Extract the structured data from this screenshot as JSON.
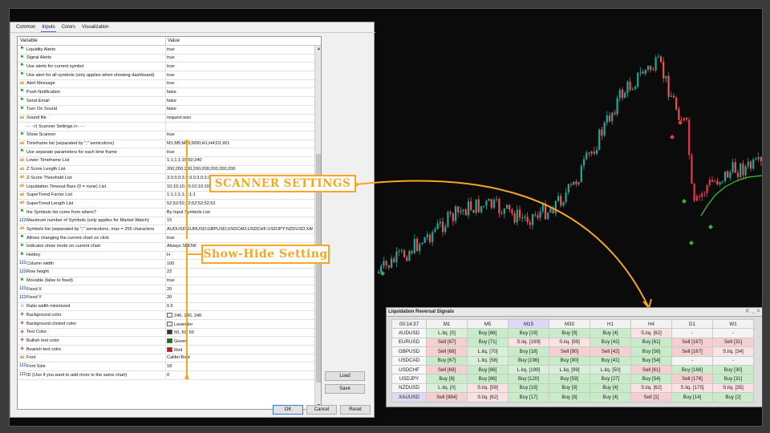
{
  "dialog": {
    "tabs": [
      {
        "label": "Common",
        "active": false
      },
      {
        "label": "Inputs",
        "active": true
      },
      {
        "label": "Colors",
        "active": false
      },
      {
        "label": "Visualization",
        "active": false
      }
    ],
    "columns": {
      "variable": "Variable",
      "value": "Value"
    },
    "rows": [
      {
        "icon": "flag",
        "label": "Liquidity Alerts",
        "value": "true"
      },
      {
        "icon": "flag",
        "label": "Signal Alerts",
        "value": "true"
      },
      {
        "icon": "flag",
        "label": "Use alerts for current symbol",
        "value": "true"
      },
      {
        "icon": "flag",
        "label": "Use alert for all symbols (only applies when showing dashboard)",
        "value": "true"
      },
      {
        "icon": "ab",
        "label": "Alert Message",
        "value": "true"
      },
      {
        "icon": "flag",
        "label": "Push Notification",
        "value": "false"
      },
      {
        "icon": "flag",
        "label": "Send Email",
        "value": "false"
      },
      {
        "icon": "flag",
        "label": "Turn On Sound",
        "value": "false"
      },
      {
        "icon": "ab",
        "label": "Sound file",
        "value": "request.wav"
      },
      {
        "icon": "",
        "label": "- - ->| Scanner Settings |<- - -",
        "value": ""
      },
      {
        "icon": "flag",
        "label": "Show Scanner",
        "value": "true"
      },
      {
        "icon": "ab",
        "label": "Timeframe list (separated by \";\" semicolons)",
        "value": "M1;M5;M15;M30;H1;H4;D1;W1"
      },
      {
        "icon": "flag",
        "label": "Use separate parameters for each time frame",
        "value": "true"
      },
      {
        "icon": "ab",
        "label": "Lower Timeframe List",
        "value": "1;1;1;1;15;60;240"
      },
      {
        "icon": "ab",
        "label": "Z Score Length List",
        "value": "200;200;200;200;200;200;200;200"
      },
      {
        "icon": "ab",
        "label": "Z-Score Threshold List",
        "value": "3.0;3.0;3.0;3.0;3.0;3.0;3.0;3.0"
      },
      {
        "icon": "ab",
        "label": "Liquidation Timeout Bars (0 = none) List",
        "value": "10;10;10;10;10;10;10;10"
      },
      {
        "icon": "ab",
        "label": "SuperTrend Factor List",
        "value": "1;1;1;1;1;1;1;1"
      },
      {
        "icon": "ab",
        "label": "SuperTrend Length List",
        "value": "52;52;52;52;52;52;52;52"
      },
      {
        "icon": "flag",
        "label": "the Symbols list come from where?",
        "value": "By Input Symbols List"
      },
      {
        "icon": "num",
        "label": "Maximum number of Symbols (only applies for Market Watch)",
        "value": "15"
      },
      {
        "icon": "ab",
        "label": "Symbols list (separated by \";\" semicolons, max = 255 characters",
        "value": "AUDUSD;EURUSD;GBPUSD;USDCAD;USDCHF;USDJPY;NZDUSD;XAUUSD"
      },
      {
        "icon": "flag",
        "label": "Allows changing the current chart on click",
        "value": "true"
      },
      {
        "icon": "flag",
        "label": "Indicator show mode on current chart",
        "value": "Always SHOW"
      },
      {
        "icon": "flag",
        "label": "Hotkey",
        "value": "H"
      },
      {
        "icon": "num",
        "label": "Column width",
        "value": "100"
      },
      {
        "icon": "num",
        "label": "Row height",
        "value": "22"
      },
      {
        "icon": "flag",
        "label": "Movable (false to fixed)",
        "value": "true"
      },
      {
        "icon": "num",
        "label": "Fixed X",
        "value": "20"
      },
      {
        "icon": "num",
        "label": "Fixed Y",
        "value": "20"
      },
      {
        "icon": "frac",
        "label": "Ratio width minimized",
        "value": "0.5"
      },
      {
        "icon": "color",
        "label": "Background color",
        "value": "240, 240, 240",
        "swatch": "#f0f0f0"
      },
      {
        "icon": "color",
        "label": "Background clicked color",
        "value": "Lavender",
        "swatch": "#e6e6fa"
      },
      {
        "icon": "color",
        "label": "Text Color",
        "value": "50, 50, 50",
        "swatch": "#323232"
      },
      {
        "icon": "color",
        "label": "Bullish text color",
        "value": "Green",
        "swatch": "#008000"
      },
      {
        "icon": "color",
        "label": "Bearish text color",
        "value": "Red",
        "swatch": "#ff0000"
      },
      {
        "icon": "ab",
        "label": "Font",
        "value": "Calibri Bold"
      },
      {
        "icon": "num",
        "label": "Font Size",
        "value": "18"
      },
      {
        "icon": "num",
        "label": "ID (Use if you want to add more to the same chart)",
        "value": "0"
      }
    ],
    "buttons": {
      "load": "Load",
      "save": "Save",
      "ok": "OK",
      "cancel": "Cancel",
      "reset": "Reset"
    }
  },
  "callouts": {
    "scanner": "SCANNER SETTINGS",
    "showhide": "Show-Hide Setting"
  },
  "accent": "#f6a722",
  "dashboard": {
    "title": "Liquidation Reversal Signals",
    "controls": [
      "⇱",
      "_",
      "x"
    ],
    "time": "00:14:37",
    "timeframes": [
      "M1",
      "M5",
      "M15",
      "M30",
      "H1",
      "H4",
      "D1",
      "W1"
    ],
    "selected_timeframe": "M15",
    "selected_symbol": "XAUUSD",
    "rows": [
      {
        "symbol": "AUDUSD",
        "cells": [
          "L.liq. [0]",
          "Buy [66]",
          "Buy [19]",
          "Buy [9]",
          "Buy [4]",
          "S.liq. [62]",
          "-",
          "-"
        ]
      },
      {
        "symbol": "EURUSD",
        "cells": [
          "Sell [67]",
          "Buy [71]",
          "S.liq. [199]",
          "S.liq. [99]",
          "Buy [42]",
          "Buy [61]",
          "Sell [167]",
          "Sell [31]"
        ]
      },
      {
        "symbol": "GBPUSD",
        "cells": [
          "Sell [68]",
          "L.liq. [70]",
          "Buy [18]",
          "Sell [90]",
          "Sell [42]",
          "Buy [56]",
          "Sell [167]",
          "S.liq. [34]"
        ]
      },
      {
        "symbol": "USDCAD",
        "cells": [
          "Buy [67]",
          "L.liq. [58]",
          "Buy [196]",
          "Buy [90]",
          "Buy [41]",
          "Buy [54]",
          "-",
          "-"
        ]
      },
      {
        "symbol": "USDCHF",
        "cells": [
          "Sell [69]",
          "Buy [66]",
          "L.liq. [199]",
          "L.liq. [99]",
          "L.liq. [50]",
          "Sell [61]",
          "Buy [168]",
          "Buy [30]"
        ]
      },
      {
        "symbol": "USDJPY",
        "cells": [
          "Buy [6]",
          "Buy [66]",
          "Buy [120]",
          "Buy [59]",
          "Buy [27]",
          "Buy [54]",
          "Sell [176]",
          "Buy [31]"
        ]
      },
      {
        "symbol": "NZDUSD",
        "cells": [
          "L.liq. [0]",
          "S.liq. [59]",
          "Buy [19]",
          "Buy [9]",
          "Buy [4]",
          "S.liq. [62]",
          "S.liq. [175]",
          "S.liq. [35]"
        ]
      },
      {
        "symbol": "XAUUSD",
        "cells": [
          "Sell [984]",
          "S.liq. [62]",
          "Buy [17]",
          "Buy [8]",
          "Buy [4]",
          "Sell [1]",
          "Buy [14]",
          "Buy [2]"
        ]
      }
    ]
  }
}
